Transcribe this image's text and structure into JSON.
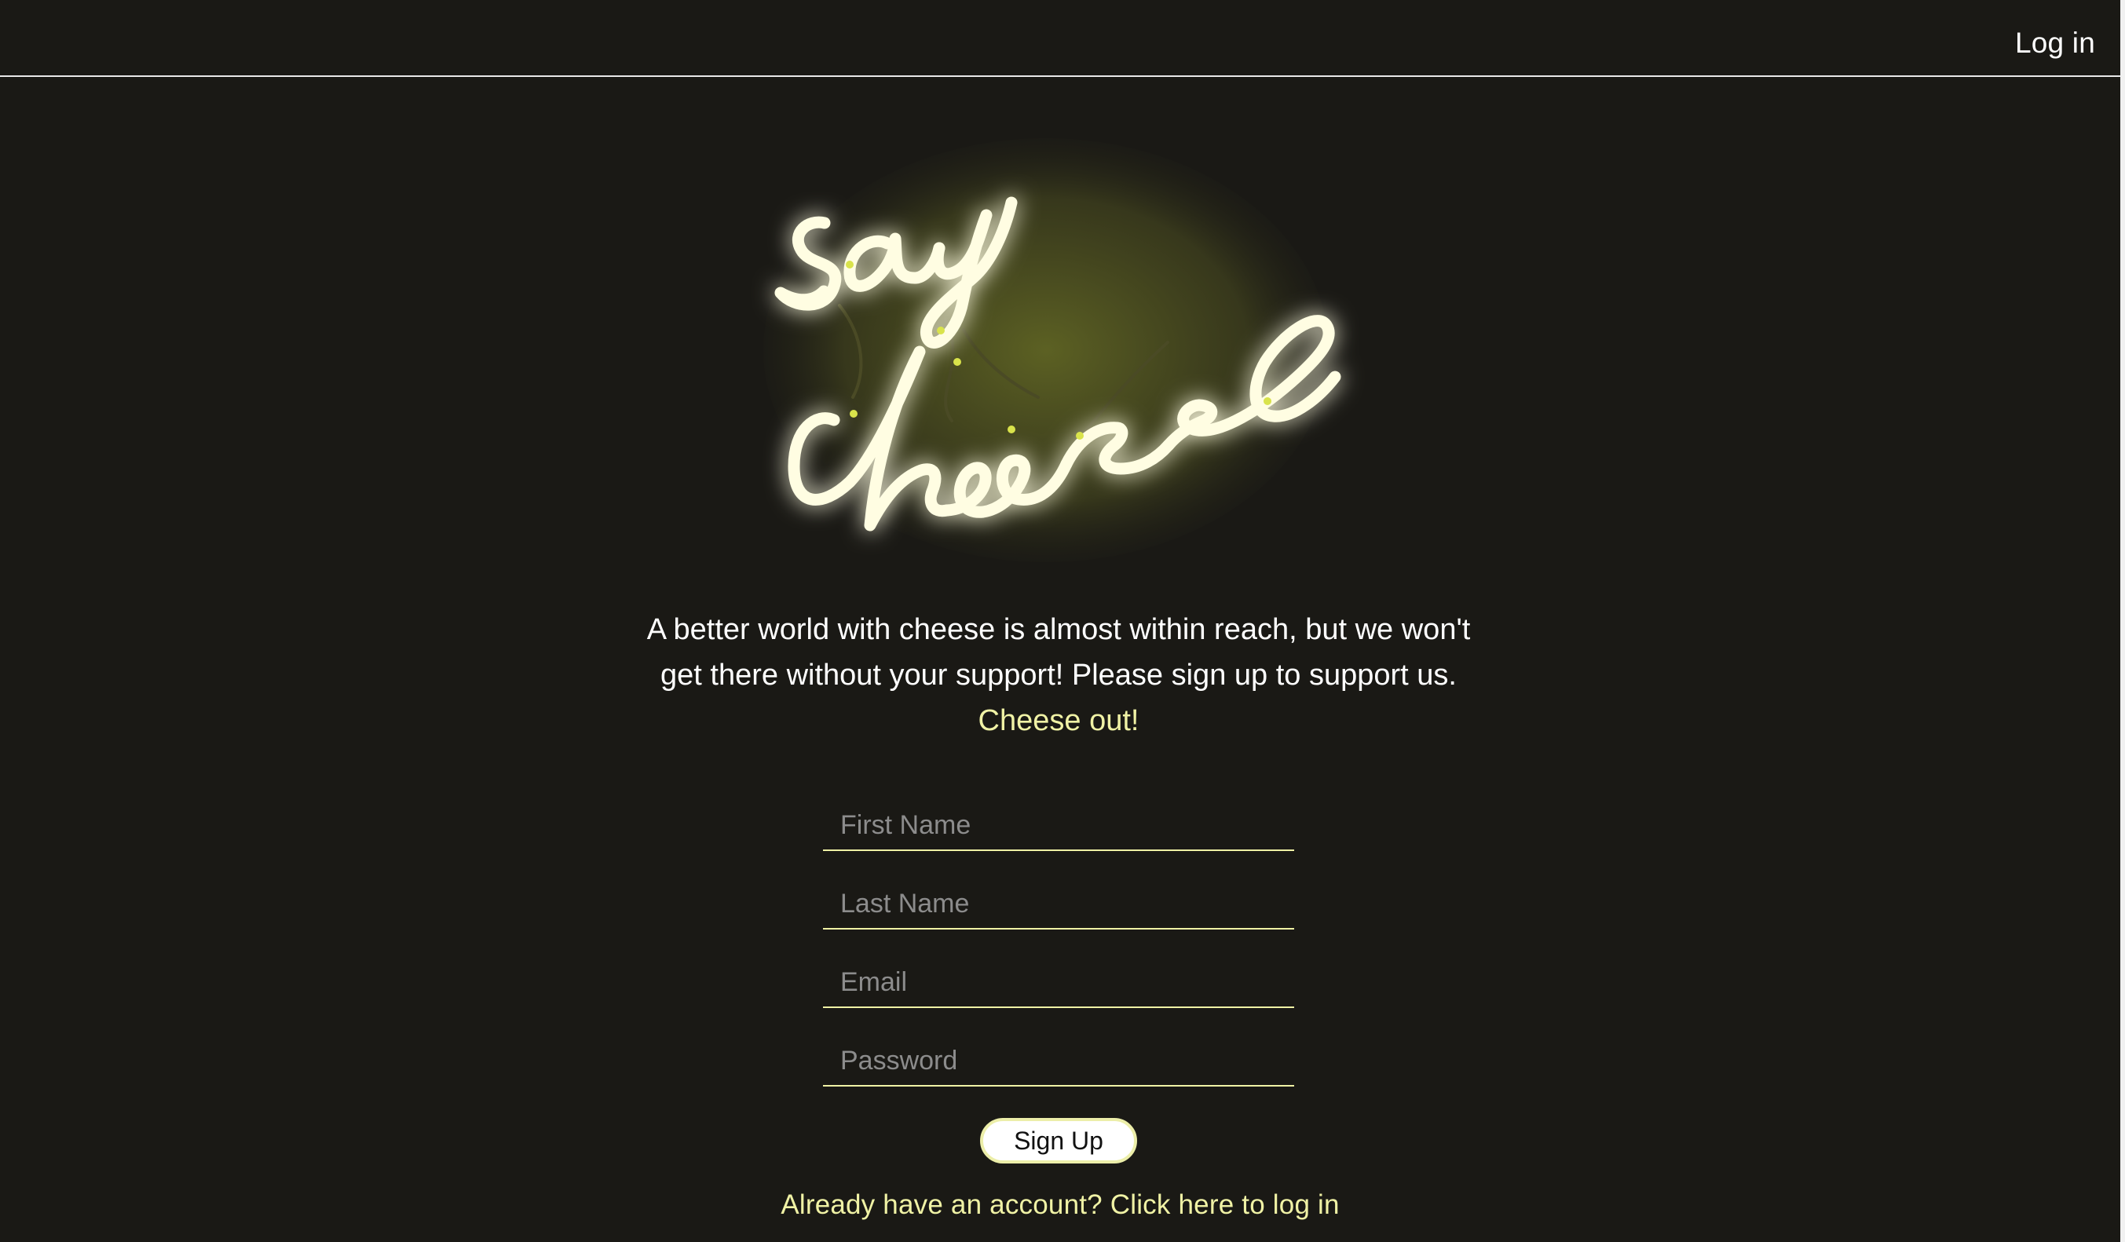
{
  "header": {
    "login_label": "Log in"
  },
  "hero": {
    "logo_alt": "say cheese"
  },
  "intro": {
    "line1": "A better world with cheese is almost within reach, but we won't",
    "line2": "get there without your support! Please sign up to support us.",
    "accent": "Cheese out!"
  },
  "form": {
    "first_name_placeholder": "First Name",
    "last_name_placeholder": "Last Name",
    "email_placeholder": "Email",
    "password_placeholder": "Password",
    "signup_label": "Sign Up"
  },
  "footer": {
    "login_prompt": "Already have an account? Click here to log in"
  },
  "colors": {
    "background": "#1a1915",
    "accent": "#f0f2a5",
    "text": "#ffffff"
  }
}
